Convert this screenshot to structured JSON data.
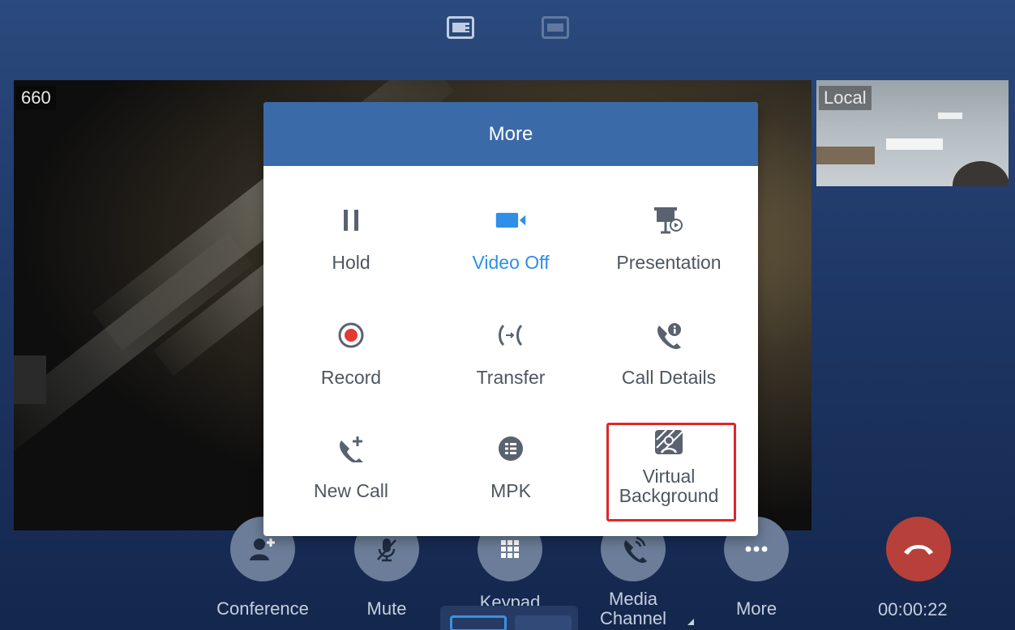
{
  "top_bar": {
    "layout_icons": [
      "layout-main-side-icon",
      "layout-split-icon"
    ]
  },
  "remote": {
    "label": "660"
  },
  "local": {
    "label": "Local"
  },
  "modal": {
    "title": "More",
    "items": [
      {
        "label": "Hold",
        "icon": "pause-icon",
        "active": false
      },
      {
        "label": "Video Off",
        "icon": "video-camera-icon",
        "active": true
      },
      {
        "label": "Presentation",
        "icon": "presentation-icon",
        "active": false
      },
      {
        "label": "Record",
        "icon": "record-icon",
        "active": false
      },
      {
        "label": "Transfer",
        "icon": "transfer-icon",
        "active": false
      },
      {
        "label": "Call Details",
        "icon": "call-details-icon",
        "active": false
      },
      {
        "label": "New Call",
        "icon": "new-call-icon",
        "active": false
      },
      {
        "label": "MPK",
        "icon": "mpk-icon",
        "active": false
      },
      {
        "label": "Virtual\nBackground",
        "label_line1": "Virtual",
        "label_line2": "Background",
        "icon": "virtual-background-icon",
        "active": false,
        "highlighted": true
      }
    ]
  },
  "toolbar": {
    "conference_label": "Conference",
    "mute_label": "Mute",
    "keypad_label": "Keypad",
    "media_channel_line1": "Media",
    "media_channel_line2": "Channel",
    "more_label": "More"
  },
  "call": {
    "timer": "00:00:22"
  },
  "colors": {
    "accent": "#2f8fe6",
    "header": "#3b6aa9",
    "hangup": "#b8403a",
    "highlight": "#e0262a"
  }
}
